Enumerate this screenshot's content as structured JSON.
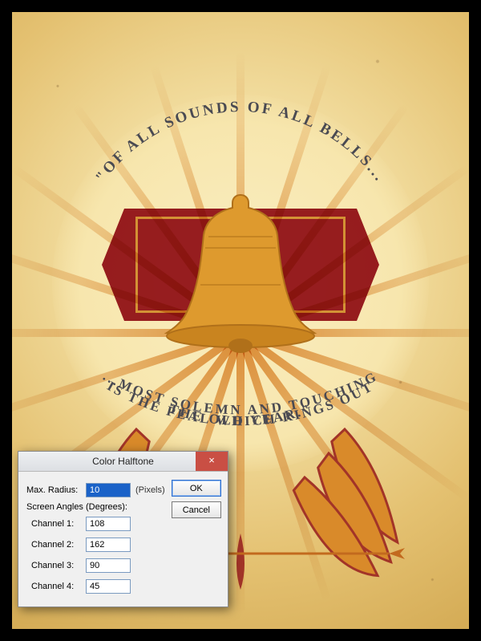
{
  "artwork": {
    "top_arc": "\"OF ALL SOUNDS OF ALL BELLS...",
    "bottom_line1": "...MOST SOLEMN AND TOUCHING",
    "bottom_line2": "IS THE PEAL WHICH RINGS OUT",
    "bottom_line3": "THE OLD YEAR.\""
  },
  "dialog": {
    "title": "Color Halftone",
    "max_radius_label": "Max. Radius:",
    "max_radius_value": "10",
    "pixels_label": "(Pixels)",
    "angles_label": "Screen Angles (Degrees):",
    "channels": [
      {
        "label": "Channel 1:",
        "value": "108"
      },
      {
        "label": "Channel 2:",
        "value": "162"
      },
      {
        "label": "Channel 3:",
        "value": "90"
      },
      {
        "label": "Channel 4:",
        "value": "45"
      }
    ],
    "ok": "OK",
    "cancel": "Cancel",
    "close": "×"
  },
  "colors": {
    "banner": "#9a1f2a",
    "bell": "#de9a2e",
    "ray": "#db8628",
    "ink": "#4a4a52"
  }
}
